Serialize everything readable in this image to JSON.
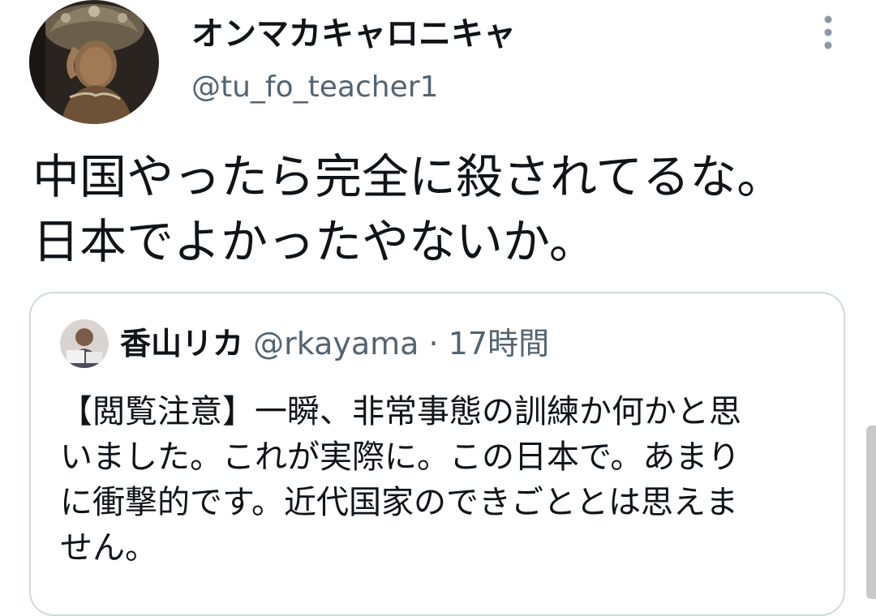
{
  "tweet": {
    "display_name": "オンマカキャロニキャ",
    "handle": "@tu_fo_teacher1",
    "text_lines": [
      "中国やったら完全に殺されてるな。",
      "日本でよかったやないか。"
    ],
    "more_icon": "more-vertical-icon"
  },
  "quote": {
    "display_name": "香山リカ",
    "handle": "@rkayama",
    "separator": "·",
    "time": "17時間",
    "text_lines": [
      "【閲覧注意】一瞬、非常事態の訓練か何かと思",
      "いました。これが実際に。この日本で。あまり",
      "に衝撃的です。近代国家のできごととは思えま",
      "せん。"
    ]
  },
  "colors": {
    "text_primary": "#0f1419",
    "text_secondary": "#536471",
    "card_border": "#cfd9de"
  }
}
